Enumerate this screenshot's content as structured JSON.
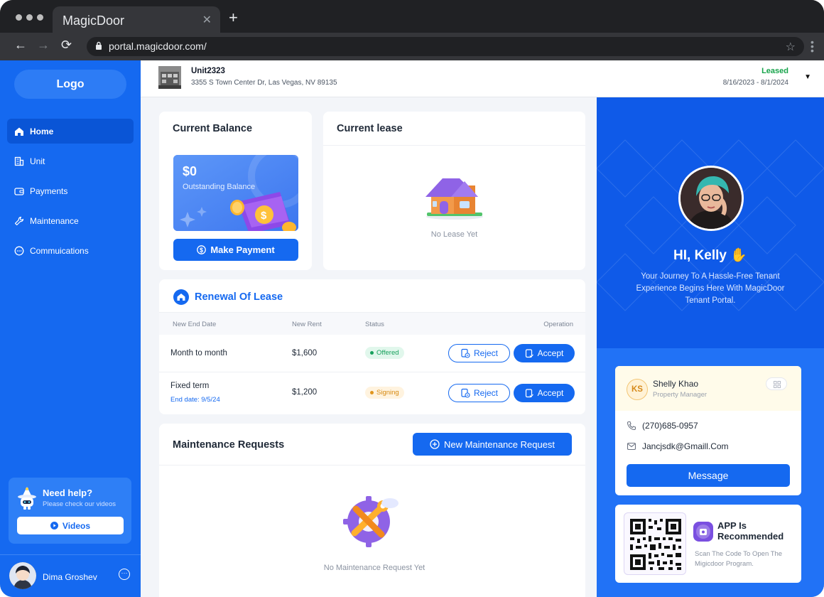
{
  "browser": {
    "tab_title": "MagicDoor",
    "url": "portal.magicdoor.com/"
  },
  "sidebar": {
    "logo": "Logo",
    "items": [
      {
        "label": "Home",
        "icon": "home-icon",
        "active": true
      },
      {
        "label": "Unit",
        "icon": "building-icon",
        "active": false
      },
      {
        "label": "Payments",
        "icon": "wallet-icon",
        "active": false
      },
      {
        "label": "Maintenance",
        "icon": "wrench-icon",
        "active": false
      },
      {
        "label": "Commuications",
        "icon": "chat-icon",
        "active": false
      }
    ],
    "help": {
      "title": "Need help?",
      "subtitle": "Please check our videos",
      "button": "Videos"
    },
    "user": {
      "name": "Dima Groshev"
    }
  },
  "header": {
    "unit_name": "Unit2323",
    "address": "3355 S Town Center Dr, Las Vegas, NV 89135",
    "status": "Leased",
    "dates": "8/16/2023 - 8/1/2024"
  },
  "balance": {
    "title": "Current Balance",
    "amount": "$0",
    "label": "Outstanding Balance",
    "button": "Make Payment"
  },
  "lease": {
    "title": "Current lease",
    "empty": "No Lease Yet"
  },
  "renewal": {
    "title": "Renewal Of Lease",
    "columns": [
      "New End Date",
      "New Rent",
      "Status",
      "Operation"
    ],
    "rows": [
      {
        "end": "Month to month",
        "end_sub": "",
        "rent": "$1,600",
        "status": "Offered",
        "reject": "Reject",
        "accept": "Accept"
      },
      {
        "end": "Fixed term",
        "end_sub": "End date: 9/5/24",
        "rent": "$1,200",
        "status": "Signing",
        "reject": "Reject",
        "accept": "Accept"
      }
    ]
  },
  "maintenance": {
    "title": "Maintenance Requests",
    "button": "New Maintenance Request",
    "empty": "No Maintenance Request Yet"
  },
  "welcome": {
    "greeting": "HI, Kelly",
    "message": "Your Journey To A Hassle-Free Tenant Experience Begins Here With MagicDoor Tenant Portal."
  },
  "manager": {
    "initials": "KS",
    "name": "Shelly Khao",
    "role": "Property Manager",
    "phone": "(270)685-0957",
    "email": "Jancjsdk@Gmaill.Com",
    "button": "Message"
  },
  "app_promo": {
    "title": "APP Is Recommended",
    "subtitle": "Scan The Code To Open The Migicdoor Program."
  },
  "colors": {
    "primary": "#1569f0",
    "sidebar": "#1569f0",
    "leased": "#16a34a",
    "offered": "#17a05c",
    "signing": "#d78a12"
  }
}
